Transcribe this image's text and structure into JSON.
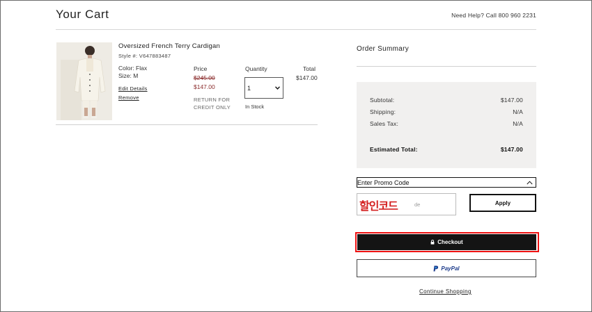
{
  "header": {
    "title": "Your Cart",
    "help_text": "Need Help? Call 800 960 2231"
  },
  "item": {
    "name": "Oversized French Terry Cardigan",
    "style": "Style #: V647883487",
    "color": "Color: Flax",
    "size": "Size: M",
    "edit_label": "Edit Details",
    "remove_label": "Remove",
    "price_header": "Price",
    "price_original": "$245.00",
    "price_sale": "$147.00",
    "return_note": "RETURN FOR CREDIT ONLY",
    "quantity_header": "Quantity",
    "quantity_value": "1",
    "stock_status": "In Stock",
    "total_header": "Total",
    "total_value": "$147.00"
  },
  "summary": {
    "title": "Order Summary",
    "rows": [
      {
        "label": "Subtotal:",
        "value": "$147.00"
      },
      {
        "label": "Shipping:",
        "value": "N/A"
      },
      {
        "label": "Sales Tax:",
        "value": "N/A"
      }
    ],
    "estimated_label": "Estimated Total:",
    "estimated_value": "$147.00"
  },
  "promo": {
    "toggle_label": "Enter Promo Code",
    "input_placeholder": "de",
    "overlay_text": "할인코드",
    "apply_label": "Apply"
  },
  "actions": {
    "checkout_label": "Checkout",
    "paypal_label": "PayPal",
    "continue_label": "Continue Shopping"
  },
  "colors": {
    "sale_price": "#8a2c2c",
    "checkout_bg": "#141414",
    "highlight": "#e11111",
    "paypal_blue": "#1b3a8a"
  }
}
